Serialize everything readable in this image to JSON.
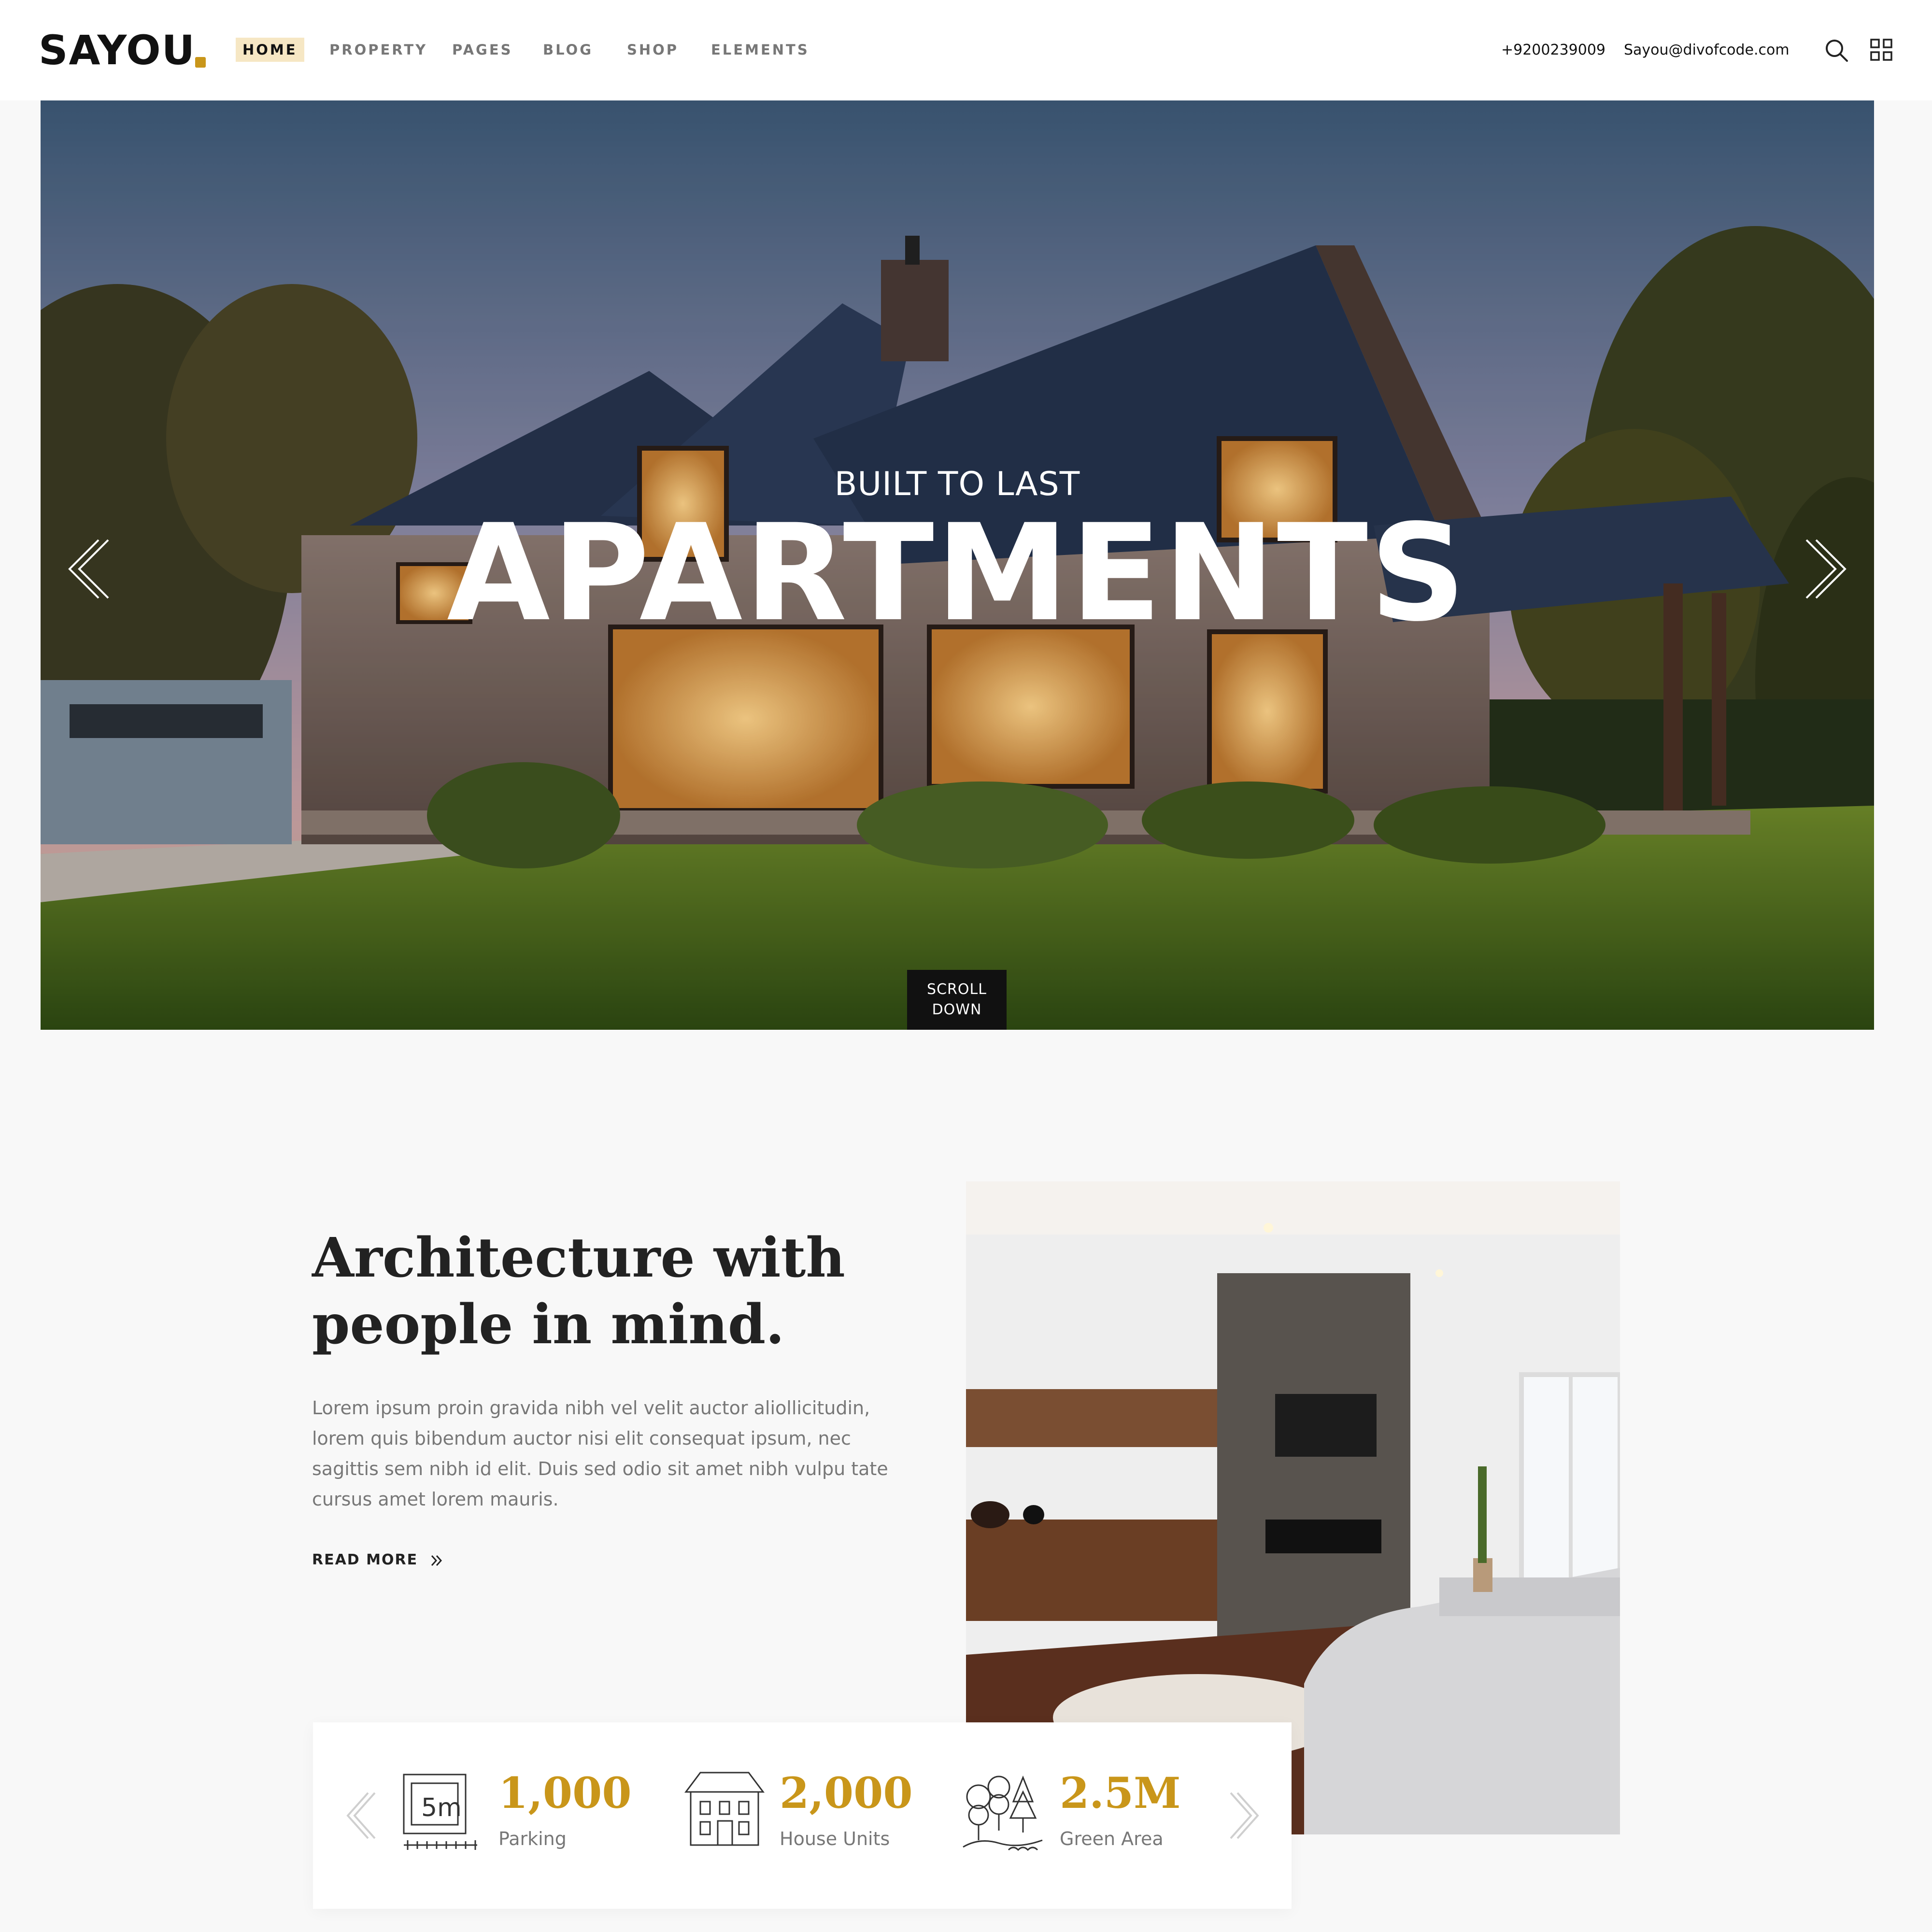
{
  "brand": {
    "logo_text": "SAYOU",
    "accent_color": "#c9961a"
  },
  "nav": {
    "items": [
      {
        "label": "HOME",
        "active": true
      },
      {
        "label": "PROPERTY",
        "active": false
      },
      {
        "label": "PAGES",
        "active": false
      },
      {
        "label": "BLOG",
        "active": false
      },
      {
        "label": "SHOP",
        "active": false
      },
      {
        "label": "ELEMENTS",
        "active": false
      }
    ]
  },
  "contact": {
    "phone": "+9200239009",
    "email": "Sayou@divofcode.com"
  },
  "header_icons": [
    "search-icon",
    "grid-menu-icon"
  ],
  "hero": {
    "subtitle": "BUILT TO LAST",
    "title": "APARTMENTS",
    "scroll_line1": "SCROLL",
    "scroll_line2": "DOWN",
    "prev_icon": "chevron-left-icon",
    "next_icon": "chevron-right-icon"
  },
  "about": {
    "heading_line1": "Architecture with",
    "heading_line2": "people in mind.",
    "body": "Lorem ipsum proin gravida nibh vel velit auctor alioll­icitudin, lorem quis bibendum auctor nisi elit consequat ipsum, nec sagittis sem nibh id elit. Duis sed odio sit amet nibh vulpu tate cursus amet lorem mauris.",
    "read_more": "READ MORE"
  },
  "stats": {
    "items": [
      {
        "value": "1,000",
        "label": "Parking",
        "icon": "parking-area-icon",
        "icon_text": "5m"
      },
      {
        "value": "2,000",
        "label": "House Units",
        "icon": "house-icon"
      },
      {
        "value": "2.5M",
        "label": "Green Area",
        "icon": "trees-icon"
      }
    ]
  }
}
